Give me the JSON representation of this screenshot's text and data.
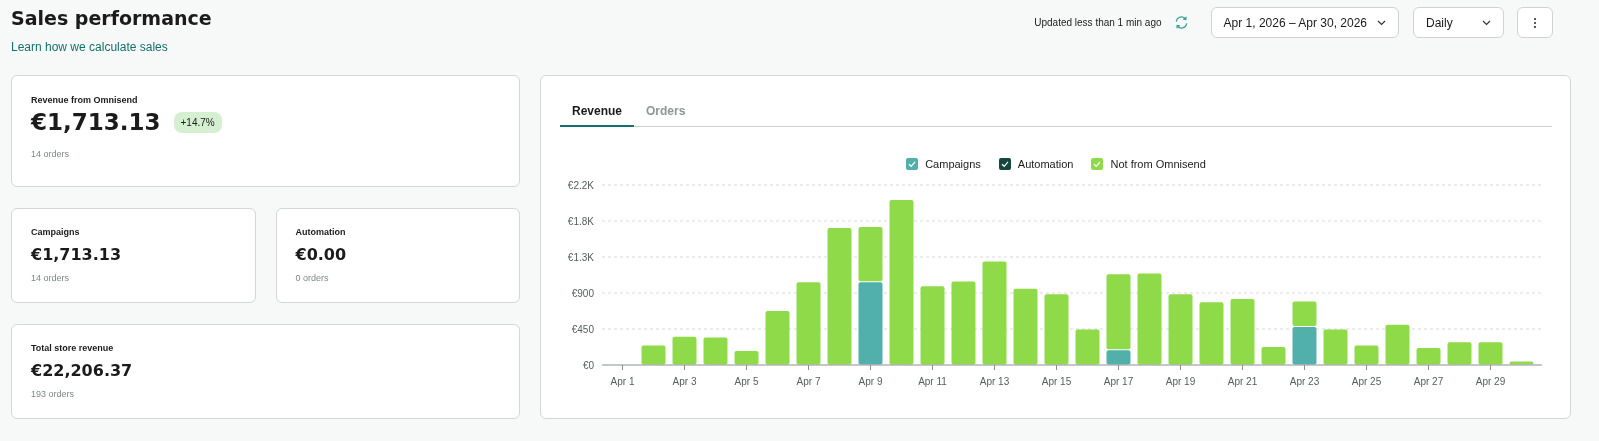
{
  "header": {
    "title": "Sales performance",
    "link": "Learn how we calculate sales",
    "updated": "Updated less than 1 min ago",
    "date_range": "Apr 1, 2026 – Apr 30, 2026",
    "interval": "Daily"
  },
  "summary": {
    "label": "Revenue from Omnisend",
    "value": "€1,713.13",
    "change": "+14.7%",
    "orders": "14 orders"
  },
  "breakdown": [
    {
      "label": "Campaigns",
      "value": "€1,713.13",
      "orders": "14 orders"
    },
    {
      "label": "Automation",
      "value": "€0.00",
      "orders": "0 orders"
    }
  ],
  "total": {
    "label": "Total store revenue",
    "value": "€22,206.37",
    "orders": "193 orders"
  },
  "chart_panel": {
    "tabs": [
      {
        "label": "Revenue",
        "selected": true
      },
      {
        "label": "Orders",
        "selected": false
      }
    ],
    "legend_checked": [
      true,
      true,
      true
    ],
    "chart_data": {
      "type": "bar",
      "stacked": true,
      "grid": true,
      "categories": [
        "Apr 1",
        null,
        "Apr 3",
        null,
        "Apr 5",
        null,
        "Apr 7",
        null,
        "Apr 9",
        null,
        "Apr 11",
        null,
        "Apr 13",
        null,
        "Apr 15",
        null,
        "Apr 17",
        null,
        "Apr 19",
        null,
        "Apr 21",
        null,
        "Apr 23",
        null,
        "Apr 25",
        null,
        "Apr 27",
        null,
        "Apr 29",
        null
      ],
      "ylim": [
        0,
        2250
      ],
      "yticks": [
        {
          "value": 0,
          "label": "€0"
        },
        {
          "value": 450,
          "label": "€450"
        },
        {
          "value": 900,
          "label": "€900"
        },
        {
          "value": 1350,
          "label": "€1.3K"
        },
        {
          "value": 1800,
          "label": "€1.8K"
        },
        {
          "value": 2250,
          "label": "€2.2K"
        }
      ],
      "series": [
        {
          "name": "Campaigns",
          "color": "#52b0ab",
          "values": [
            0,
            0,
            0,
            0,
            0,
            0,
            0,
            0,
            1040,
            0,
            0,
            0,
            0,
            0,
            0,
            0,
            190,
            0,
            0,
            0,
            0,
            0,
            480,
            0,
            0,
            0,
            0,
            0,
            0,
            0
          ]
        },
        {
          "name": "Automation",
          "color": "#17463f",
          "values": [
            0,
            0,
            0,
            0,
            0,
            0,
            0,
            0,
            0,
            0,
            0,
            0,
            0,
            0,
            0,
            0,
            0,
            0,
            0,
            0,
            0,
            0,
            0,
            0,
            0,
            0,
            0,
            0,
            0,
            0
          ]
        },
        {
          "name": "Not from Omnisend",
          "color": "#8fda48",
          "values": [
            0,
            250,
            360,
            350,
            180,
            680,
            1040,
            1720,
            690,
            2070,
            990,
            1050,
            1300,
            960,
            890,
            450,
            950,
            1150,
            890,
            790,
            830,
            230,
            320,
            450,
            250,
            510,
            220,
            290,
            290,
            50
          ]
        }
      ]
    }
  }
}
